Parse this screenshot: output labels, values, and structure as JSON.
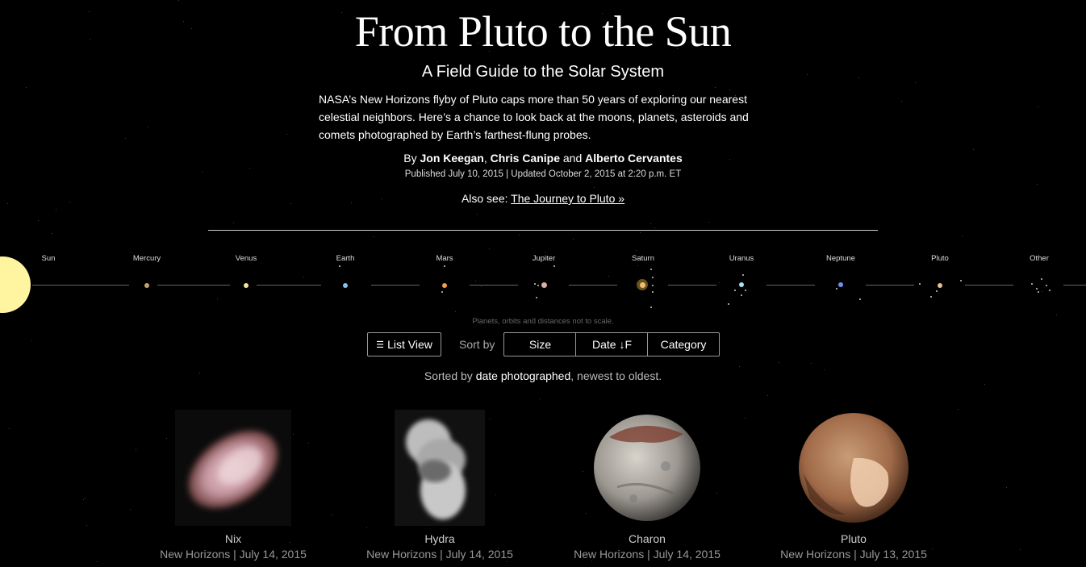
{
  "header": {
    "title": "From Pluto to the Sun",
    "subtitle": "A Field Guide to the Solar System",
    "intro": "NASA’s New Horizons flyby of Pluto caps more than 50 years of exploring our nearest celestial neighbors. Here’s a chance to look back at the moons, planets, asteroids and comets photographed by Earth’s farthest-flung probes.",
    "byline_prefix": "By",
    "author1": "Jon Keegan",
    "sep1": ",",
    "author2": "Chris Canipe",
    "and": "and",
    "author3": "Alberto Cervantes",
    "pubdate": "Published July 10, 2015 | Updated October 2, 2015 at 2:20 p.m. ET",
    "also_see_prefix": "Also see:",
    "also_see_link": "The Journey to Pluto »"
  },
  "orbit": {
    "stops": [
      "Sun",
      "Mercury",
      "Venus",
      "Earth",
      "Mars",
      "Jupiter",
      "Saturn",
      "Uranus",
      "Neptune",
      "Pluto",
      "Other"
    ],
    "scale_note": "Planets, orbits and distances not to scale."
  },
  "controls": {
    "list_view_label": "List View",
    "sort_by_label": "Sort by",
    "sort_options": [
      "Size",
      "Date ↓F",
      "Category"
    ],
    "sorted_prefix": "Sorted by",
    "sorted_key": "date photographed",
    "sorted_suffix": ", newest to oldest."
  },
  "gallery": [
    {
      "name": "Nix",
      "meta": "New Horizons | July 14, 2015"
    },
    {
      "name": "Hydra",
      "meta": "New Horizons | July 14, 2015"
    },
    {
      "name": "Charon",
      "meta": "New Horizons | July 14, 2015"
    },
    {
      "name": "Pluto",
      "meta": "New Horizons | July 13, 2015"
    }
  ],
  "colors": {
    "sun": "#fff4a0",
    "mercury": "#c9a06a",
    "venus": "#f5e2a0",
    "earth": "#7fc4f0",
    "mars": "#f0a040",
    "jupiter": "#d8b0a8",
    "saturn": "#e8c070",
    "uranus": "#a8e0f0",
    "neptune": "#7090f0",
    "pluto": "#e8c090"
  }
}
